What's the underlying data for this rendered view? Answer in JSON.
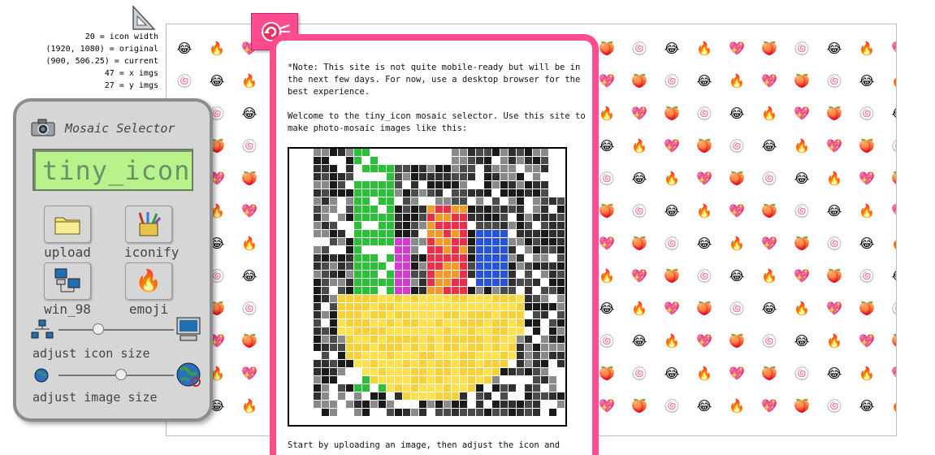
{
  "stats": {
    "lines": [
      "20 = icon width",
      "(1920, 1080) = original",
      "(900, 506.25) = current",
      "47 = x imgs",
      "27 = y imgs"
    ]
  },
  "panel": {
    "title": "Mosaic Selector",
    "lcd_text": "tiny_icon",
    "tools": [
      {
        "label": "upload",
        "icon": "folder-icon"
      },
      {
        "label": "iconify",
        "icon": "paint-brushes-icon"
      },
      {
        "label": "win_98",
        "icon": "network-computers-icon"
      },
      {
        "label": "emoji",
        "icon": "fire-icon"
      }
    ],
    "icon_size_label": "adjust icon size",
    "image_size_label": "adjust image size",
    "icon_size_value": 0.33,
    "image_size_value": 0.55
  },
  "dialog": {
    "note": "*Note: This site is not quite mobile-ready but will be in the next few days. For now, use a desktop browser for the best experience.",
    "welcome": "Welcome to the tiny_icon mosaic selector. Use this site to make photo-mosaic images like this:",
    "footer": "Start by uploading an image, then adjust the icon and"
  },
  "mosaic": {
    "emoji_cycle": [
      "😂",
      "🍑",
      "🔥",
      "🍥",
      "💖"
    ]
  },
  "colors": {
    "accent_pink": "#ff4c8f",
    "lcd_green": "#b8f28a",
    "panel_gray": "#d6d6d6"
  }
}
